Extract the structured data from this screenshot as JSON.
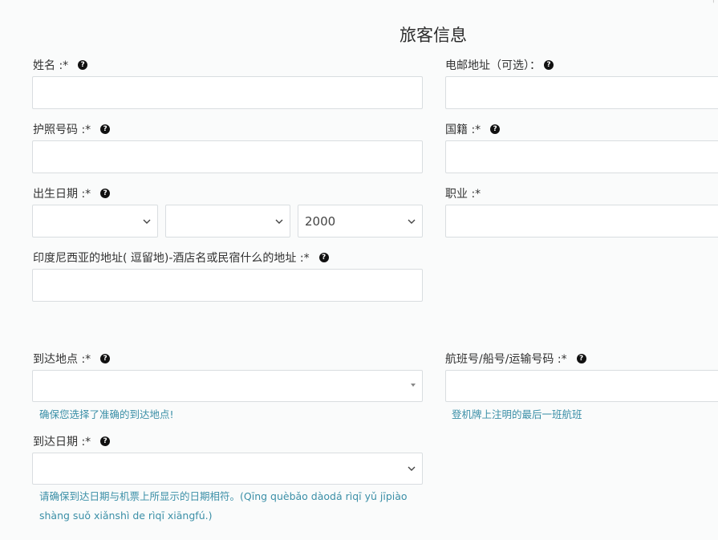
{
  "page": {
    "title": "旅客信息",
    "corner_glyph": "'"
  },
  "fields": {
    "name": {
      "label": "姓名 :*",
      "help": "?",
      "value": ""
    },
    "email": {
      "label": "电邮地址（可选）：",
      "help": "?",
      "value": ""
    },
    "passport": {
      "label": "护照号码 :*",
      "help": "?",
      "value": ""
    },
    "nationality": {
      "label": "国籍 :*",
      "help": "?",
      "value": ""
    },
    "birthdate": {
      "label": "出生日期 :*",
      "help": "?",
      "day": "",
      "month": "",
      "year": "2000"
    },
    "occupation": {
      "label": "职业 :*",
      "value": ""
    },
    "address": {
      "label": "印度尼西亚的地址( 逗留地)-酒店名或民宿什么的地址 :*",
      "help": "?",
      "value": ""
    },
    "arrival_place": {
      "label": "到达地点 :*",
      "help": "?",
      "value": "",
      "hint": "确保您选择了准确的到达地点!"
    },
    "flight_number": {
      "label": "航班号/船号/运输号码 :*",
      "help": "?",
      "value": "",
      "hint": "登机牌上注明的最后一班航班"
    },
    "arrival_date": {
      "label": "到达日期 :*",
      "help": "?",
      "value": "",
      "hint_line1": "请确保到达日期与机票上所显示的日期相符。(Qīng quèbǎo dàodá rìqī yǔ jīpiào",
      "hint_line2": "shàng suǒ xiǎnshì de rìqī xiāngfú.)"
    }
  },
  "icons": {
    "help": "question-circle-icon",
    "select": "chevron-down-icon",
    "caret": "caret-down-icon"
  }
}
